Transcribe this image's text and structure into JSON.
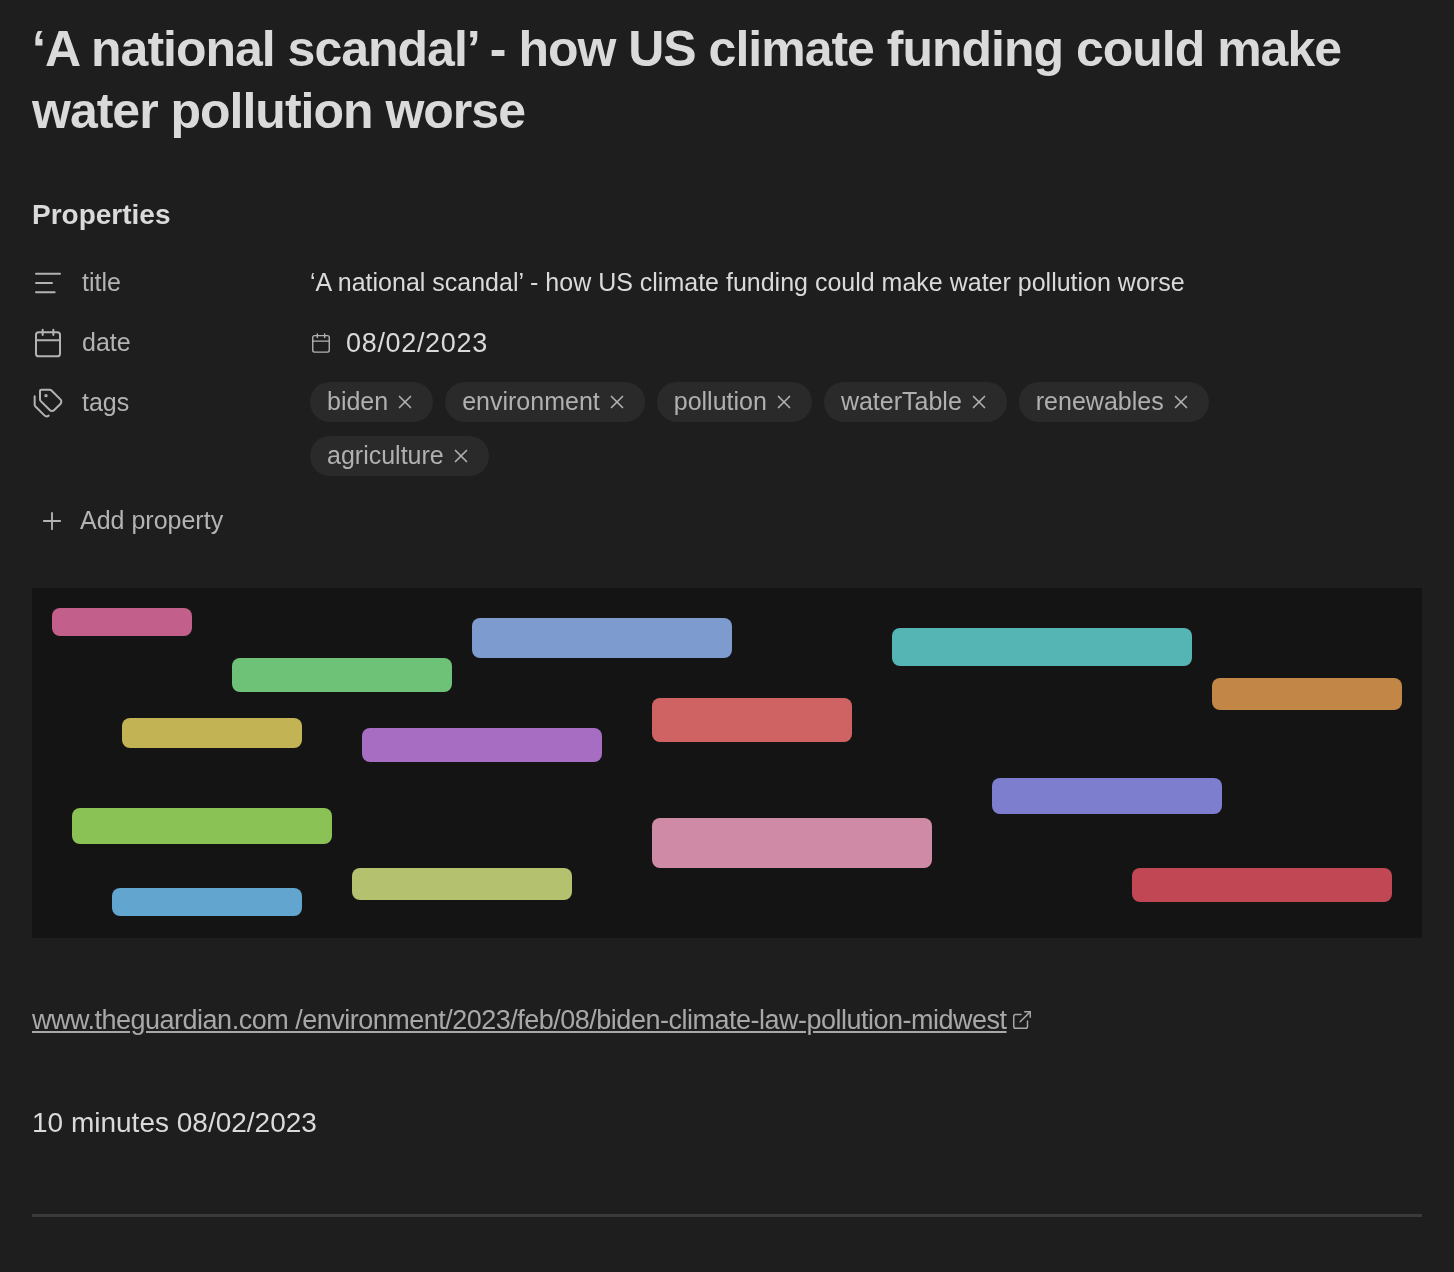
{
  "title": "‘A national scandal’ - how US climate funding could make water pollution worse",
  "properties": {
    "heading": "Properties",
    "rows": [
      {
        "kind": "text",
        "label": "title",
        "value": "‘A national scandal’ - how US climate funding could make water pollution worse"
      },
      {
        "kind": "date",
        "label": "date",
        "value": "08/02/2023"
      },
      {
        "kind": "tags",
        "label": "tags",
        "tags": [
          "biden",
          "environment",
          "pollution",
          "waterTable",
          "renewables",
          "agriculture"
        ]
      }
    ],
    "add": "Add property"
  },
  "link": "www.theguardian.com /environment/2023/feb/08/biden-climate-law-pollution-midwest",
  "footer": "10 minutes 08/02/2023"
}
